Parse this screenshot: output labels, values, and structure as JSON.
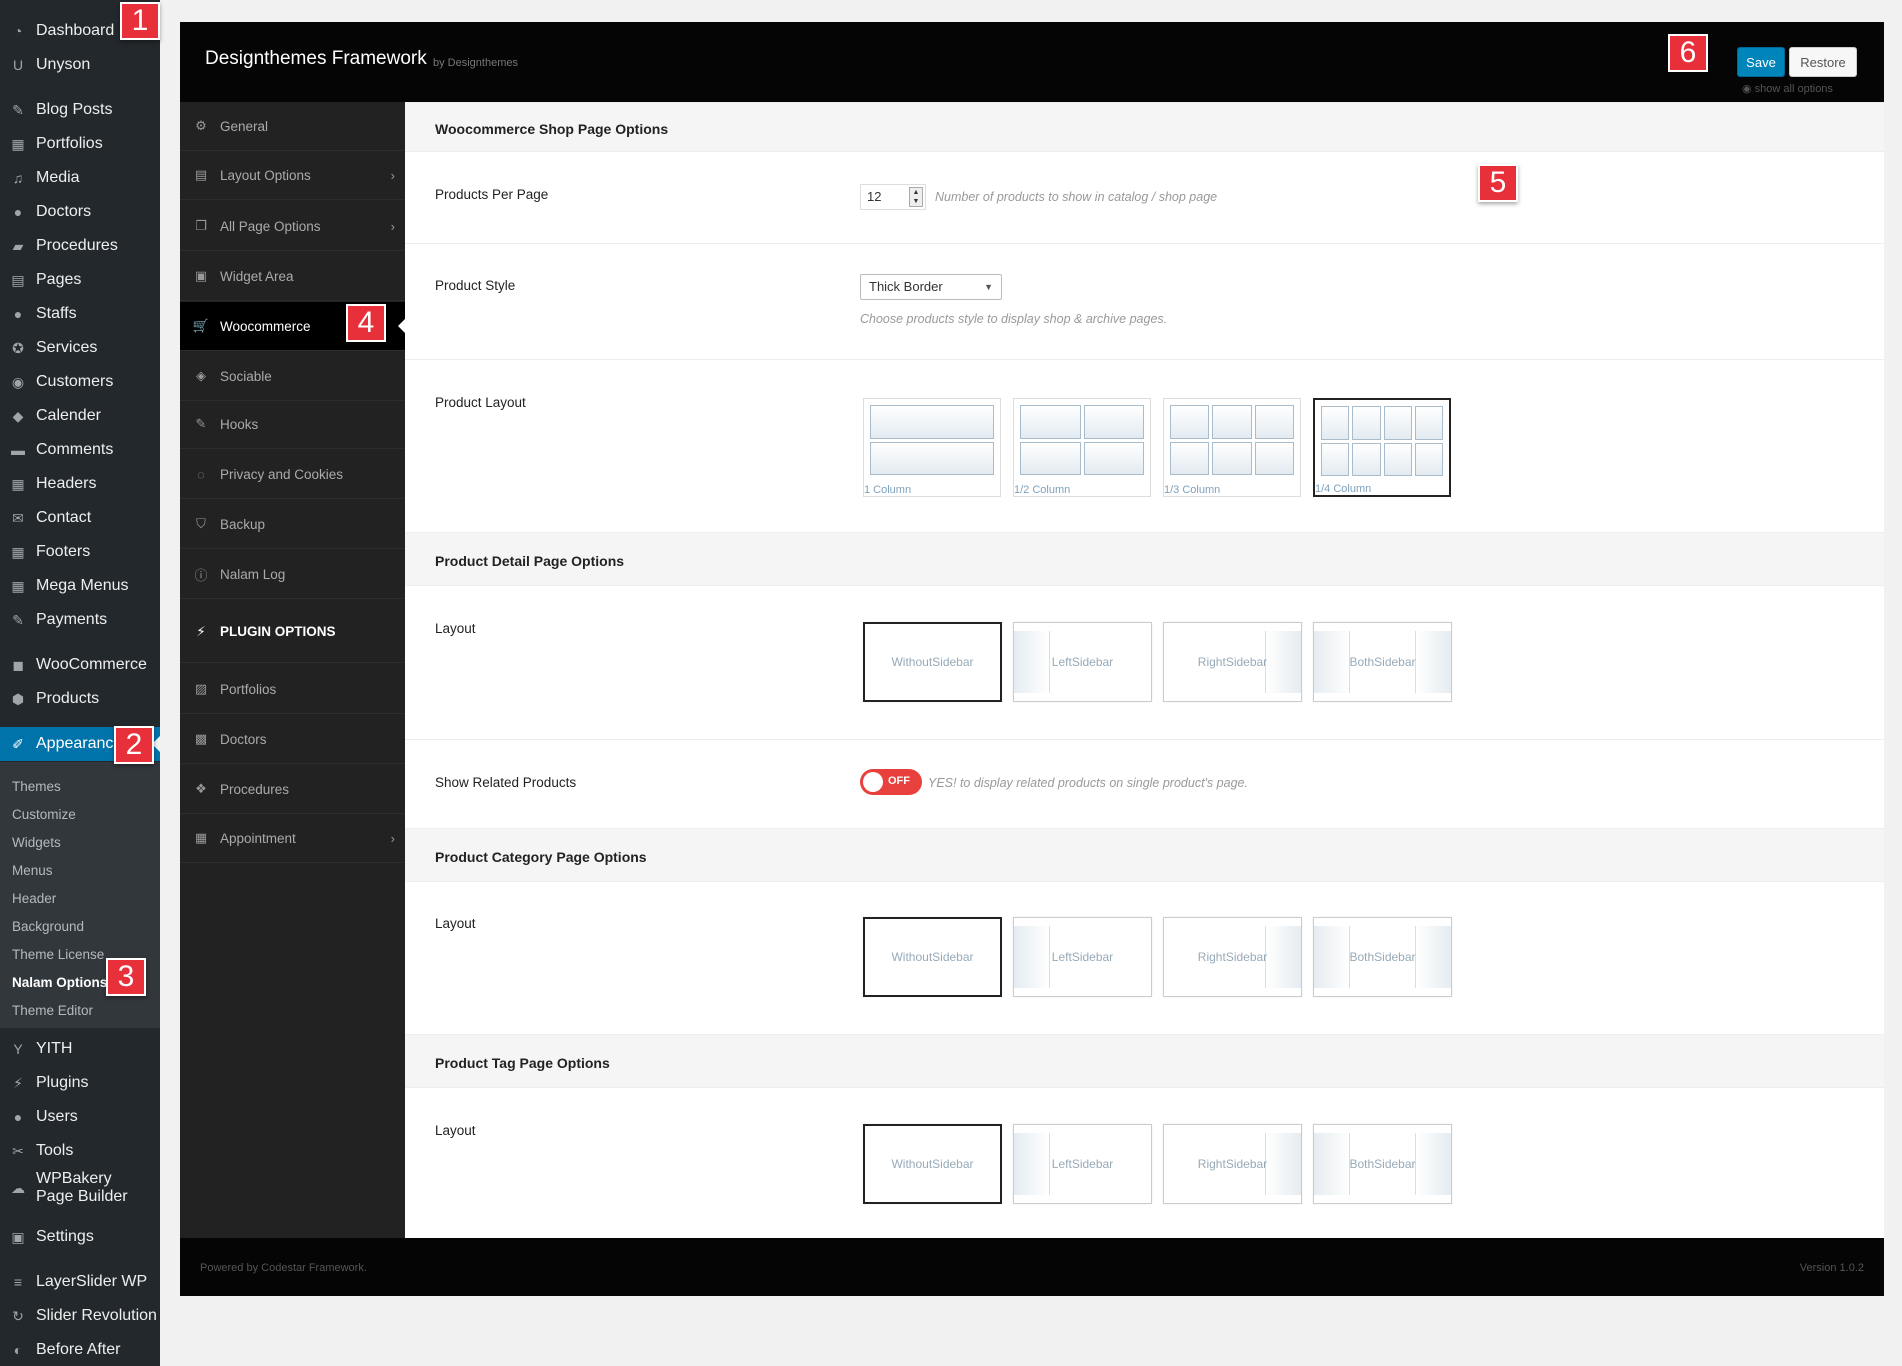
{
  "wp_menu": {
    "items": [
      {
        "label": "Dashboard",
        "icon": "dashboard-icon"
      },
      {
        "label": "Unyson",
        "icon": "unyson-icon"
      },
      {
        "label": "Blog Posts",
        "icon": "pin-icon"
      },
      {
        "label": "Portfolios",
        "icon": "portfolio-icon"
      },
      {
        "label": "Media",
        "icon": "media-icon"
      },
      {
        "label": "Doctors",
        "icon": "user-icon"
      },
      {
        "label": "Procedures",
        "icon": "folder-icon"
      },
      {
        "label": "Pages",
        "icon": "pages-icon"
      },
      {
        "label": "Staffs",
        "icon": "user-icon"
      },
      {
        "label": "Services",
        "icon": "award-icon"
      },
      {
        "label": "Customers",
        "icon": "users-icon"
      },
      {
        "label": "Calender",
        "icon": "tag-icon"
      },
      {
        "label": "Comments",
        "icon": "comment-icon"
      },
      {
        "label": "Headers",
        "icon": "grid-icon"
      },
      {
        "label": "Contact",
        "icon": "mail-icon"
      },
      {
        "label": "Footers",
        "icon": "grid-icon"
      },
      {
        "label": "Mega Menus",
        "icon": "grid-icon"
      },
      {
        "label": "Payments",
        "icon": "edit-icon"
      },
      {
        "label": "WooCommerce",
        "icon": "woo-icon"
      },
      {
        "label": "Products",
        "icon": "box-icon"
      },
      {
        "label": "Appearance",
        "icon": "brush-icon"
      },
      {
        "label": "YITH",
        "icon": "yith-icon"
      },
      {
        "label": "Plugins",
        "icon": "plug-icon"
      },
      {
        "label": "Users",
        "icon": "user-icon"
      },
      {
        "label": "Tools",
        "icon": "wrench-icon"
      },
      {
        "label": "WPBakery Page Builder",
        "icon": "cloud-icon"
      },
      {
        "label": "Settings",
        "icon": "settings-icon"
      },
      {
        "label": "LayerSlider WP",
        "icon": "layers-icon"
      },
      {
        "label": "Slider Revolution",
        "icon": "refresh-icon"
      },
      {
        "label": "Before After",
        "icon": "compare-icon"
      }
    ],
    "appearance_sub": [
      "Themes",
      "Customize",
      "Widgets",
      "Menus",
      "Header",
      "Background",
      "Theme License",
      "Nalam Options",
      "Theme Editor"
    ]
  },
  "badges": [
    "1",
    "2",
    "3",
    "4",
    "5",
    "6"
  ],
  "framework": {
    "title": "Designthemes Framework",
    "by": "by Designthemes",
    "save": "Save",
    "restore": "Restore",
    "show_all": "show all options",
    "nav": [
      {
        "label": "General",
        "icon": "cogs-icon",
        "chevron": false
      },
      {
        "label": "Layout Options",
        "icon": "layout-icon",
        "chevron": true
      },
      {
        "label": "All Page Options",
        "icon": "copy-icon",
        "chevron": true
      },
      {
        "label": "Widget Area",
        "icon": "widget-icon",
        "chevron": false
      },
      {
        "label": "Woocommerce",
        "icon": "cart-icon",
        "chevron": false
      },
      {
        "label": "Sociable",
        "icon": "share-icon",
        "chevron": false
      },
      {
        "label": "Hooks",
        "icon": "link-icon",
        "chevron": false
      },
      {
        "label": "Privacy and Cookies",
        "icon": "eye-slash-icon",
        "chevron": false
      },
      {
        "label": "Backup",
        "icon": "shield-icon",
        "chevron": false
      },
      {
        "label": "Nalam Log",
        "icon": "info-icon",
        "chevron": false
      }
    ],
    "plugin_section": "PLUGIN OPTIONS",
    "plugin_nav": [
      {
        "label": "Portfolios",
        "icon": "image-icon",
        "chevron": false
      },
      {
        "label": "Doctors",
        "icon": "briefcase-icon",
        "chevron": false
      },
      {
        "label": "Procedures",
        "icon": "cubes-icon",
        "chevron": false
      },
      {
        "label": "Appointment",
        "icon": "calendar-icon",
        "chevron": true
      }
    ],
    "shop": {
      "heading": "Woocommerce Shop Page Options",
      "per_page_label": "Products Per Page",
      "per_page_value": "12",
      "per_page_desc": "Number of products to show in catalog / shop page",
      "style_label": "Product Style",
      "style_value": "Thick Border",
      "style_desc": "Choose products style to display shop & archive pages.",
      "layout_label": "Product Layout",
      "layouts": [
        {
          "caption": "1 Column",
          "cols": 1
        },
        {
          "caption": "1/2 Column",
          "cols": 2
        },
        {
          "caption": "1/3 Column",
          "cols": 3
        },
        {
          "caption": "1/4 Column",
          "cols": 4
        }
      ],
      "selected_layout": 3
    },
    "sidebar_options": [
      {
        "line1": "Without",
        "line2": "Sidebar",
        "type": "none"
      },
      {
        "line1": "Left",
        "line2": "Sidebar",
        "type": "left"
      },
      {
        "line1": "Right",
        "line2": "Sidebar",
        "type": "right"
      },
      {
        "line1": "Both",
        "line2": "Sidebar",
        "type": "both"
      }
    ],
    "detail": {
      "heading": "Product Detail Page Options",
      "layout_label": "Layout",
      "related_label": "Show Related Products",
      "related_toggle": "OFF",
      "related_desc": "YES! to display related products on single product's page."
    },
    "category": {
      "heading": "Product Category Page Options",
      "layout_label": "Layout"
    },
    "tag": {
      "heading": "Product Tag Page Options",
      "layout_label": "Layout"
    },
    "footer_left": "Powered by Codestar Framework.",
    "footer_right": "Version 1.0.2"
  }
}
